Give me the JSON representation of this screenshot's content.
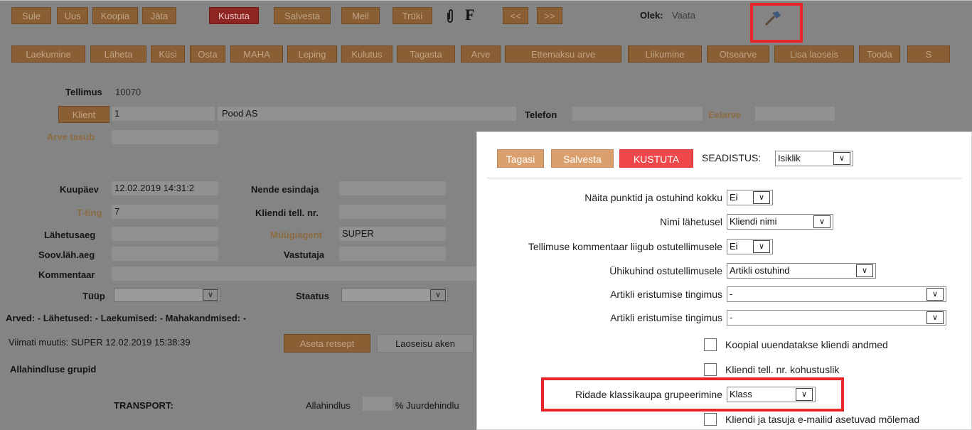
{
  "toolbar1": {
    "buttons": [
      "Sule",
      "Uus",
      "Koopia",
      "Jäta",
      "Kustuta",
      "Salvesta",
      "Meil",
      "Trüki"
    ],
    "f_label": "F",
    "prev": "<<",
    "next": ">>",
    "state_label": "Olek:",
    "state_value": "Vaata"
  },
  "toolbar2": {
    "buttons": [
      "Laekumine",
      "Läheta",
      "Küsi",
      "Osta",
      "MAHA",
      "Leping",
      "Kulutus",
      "Tagasta",
      "Arve",
      "Ettemaksu arve",
      "Liikumine",
      "Otsearve",
      "Lisa laoseis",
      "Tooda",
      "S"
    ]
  },
  "form": {
    "tellimus_label": "Tellimus",
    "tellimus_value": "10070",
    "klient_button": "Klient",
    "klient_code": "1",
    "klient_name": "Pood AS",
    "telefon_label": "Telefon",
    "eelarve_label": "Eelarve",
    "arve_tasub_label": "Arve tasub",
    "kuupaev_label": "Kuupäev",
    "kuupaev_value": "12.02.2019 14:31:2",
    "nende_esindaja_label": "Nende esindaja",
    "tting_label": "T-ting",
    "tting_value": "7",
    "kliendi_tell_label": "Kliendi tell. nr.",
    "lahetusaeg_label": "Lähetusaeg",
    "myygiagent_label": "Müügiagent",
    "myygiagent_value": "SUPER",
    "soov_label": "Soov.läh.aeg",
    "vastutaja_label": "Vastutaja",
    "kommentaar_label": "Kommentaar",
    "tyyp_label": "Tüüp",
    "staatus_label": "Staatus",
    "arved_line": "Arved: - Lähetused: - Laekumised: - Mahakandmised: -",
    "viimati_muutis": "Viimati muutis: SUPER 12.02.2019 15:38:39",
    "aseta_retsept": "Aseta retsept",
    "laoseisu_aken": "Laoseisu aken",
    "allahindluse_grupid": "Allahindluse grupid",
    "transport": "TRANSPORT:",
    "allahindlus": "Allahindlus",
    "juurdehindlus": "% Juurdehindlu"
  },
  "popup": {
    "tagasi": "Tagasi",
    "salvesta": "Salvesta",
    "kustuta": "KUSTUTA",
    "seadistus_label": "SEADISTUS:",
    "seadistus_value": "Isiklik",
    "rows": [
      {
        "label": "Näita punktid ja ostuhind kokku",
        "value": "Ei"
      },
      {
        "label": "Nimi lähetusel",
        "value": "Kliendi nimi"
      },
      {
        "label": "Tellimuse kommentaar liigub ostutellimusele",
        "value": "Ei"
      },
      {
        "label": "Ühikuhind ostutellimusele",
        "value": "Artikli ostuhind"
      },
      {
        "label": "Artikli eristumise tingimus",
        "value": "-"
      },
      {
        "label": "Artikli eristumise tingimus",
        "value": "-"
      }
    ],
    "checkboxes": [
      "Koopial uuendatakse kliendi andmed",
      "Kliendi tell. nr. kohustuslik"
    ],
    "grouping_label": "Ridade klassikaupa grupeerimine",
    "grouping_value": "Klass",
    "last_checkbox": "Kliendi ja tasuja e-mailid asetuvad mõlemad"
  },
  "colors": {
    "highlight": "#e8262b",
    "button_tan": "#d9a06e",
    "button_red": "#f0474b"
  }
}
